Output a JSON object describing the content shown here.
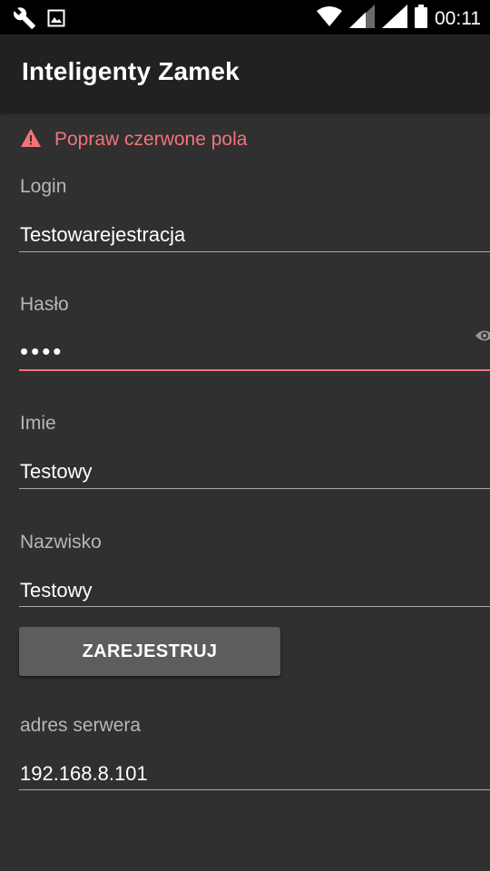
{
  "status_bar": {
    "time": "00:11",
    "icons": [
      "wrench-icon",
      "image-icon",
      "wifi-icon",
      "signal-icon",
      "signal-icon",
      "battery-icon"
    ]
  },
  "toolbar": {
    "title": "Inteligenty Zamek"
  },
  "error": {
    "icon": "warning-icon",
    "message": "Popraw czerwone pola",
    "color": "#f4727b"
  },
  "form": {
    "login": {
      "label": "Login",
      "value": "Testowarejestracja"
    },
    "password": {
      "label": "Hasło",
      "value": "••••",
      "visibility_icon": "eye-icon",
      "state": "error"
    },
    "first_name": {
      "label": "Imie",
      "value": "Testowy"
    },
    "last_name": {
      "label": "Nazwisko",
      "value": "Testowy"
    },
    "register_button": "ZAREJESTRUJ",
    "server_address": {
      "label": "adres serwera",
      "value": "192.168.8.101"
    }
  },
  "colors": {
    "background": "#303030",
    "toolbar": "#212121",
    "status_bar": "#000000",
    "accent_error": "#f4727b",
    "button": "#5d5d5d"
  }
}
